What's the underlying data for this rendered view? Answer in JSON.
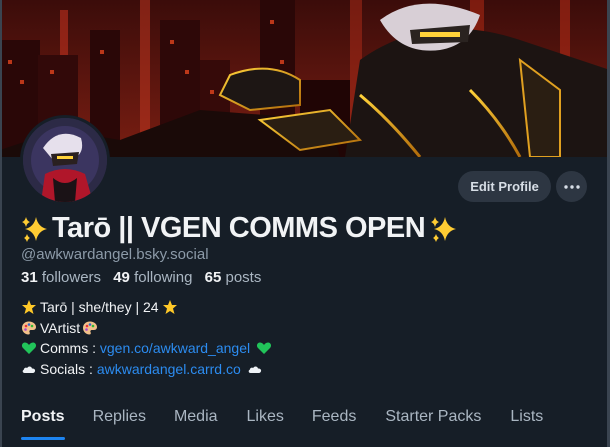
{
  "profile": {
    "display_name": "Tarō || VGEN COMMS OPEN",
    "handle": "@awkwardangel.bsky.social",
    "stats": {
      "followers_count": "31",
      "followers_label": "followers",
      "following_count": "49",
      "following_label": "following",
      "posts_count": "65",
      "posts_label": "posts"
    },
    "bio": {
      "line1": "Tarō | she/they | 24",
      "line2": "VArtist",
      "line3_label": "Comms : ",
      "line3_link": "vgen.co/awkward_angel",
      "line4_label": "Socials : ",
      "line4_link": "awkwardangel.carrd.co"
    },
    "edit_profile_label": "Edit Profile",
    "more_icon": "ellipsis-icon"
  },
  "tabs": [
    {
      "label": "Posts",
      "active": true
    },
    {
      "label": "Replies"
    },
    {
      "label": "Media"
    },
    {
      "label": "Likes"
    },
    {
      "label": "Feeds"
    },
    {
      "label": "Starter Packs"
    },
    {
      "label": "Lists"
    }
  ],
  "colors": {
    "background": "#161e27",
    "link": "#2c8cf0",
    "active_tab_underline": "#1d84f0",
    "button_bg": "#2d3642"
  }
}
